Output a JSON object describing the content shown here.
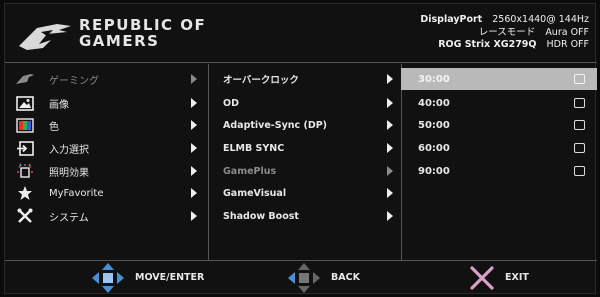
{
  "header": {
    "brand_line1": "REPUBLIC OF",
    "brand_line2": "GAMERS",
    "input": "DisplayPort",
    "resolution": "2560x1440@ 144Hz",
    "mode_label": "レースモード",
    "aura": "Aura OFF",
    "model": "ROG Strix  XG279Q",
    "hdr": "HDR OFF"
  },
  "menu": [
    {
      "label": "ゲーミング",
      "icon": "rog-eye-icon",
      "dimmed": true
    },
    {
      "label": "画像",
      "icon": "image-icon",
      "dimmed": false
    },
    {
      "label": "色",
      "icon": "color-bars-icon",
      "dimmed": false
    },
    {
      "label": "入力選択",
      "icon": "input-select-icon",
      "dimmed": false
    },
    {
      "label": "照明効果",
      "icon": "lighting-icon",
      "dimmed": false
    },
    {
      "label": "MyFavorite",
      "icon": "star-icon",
      "dimmed": false
    },
    {
      "label": "システム",
      "icon": "tools-icon",
      "dimmed": false
    }
  ],
  "submenu": [
    {
      "label": "オーバークロック",
      "dimmed": false
    },
    {
      "label": "OD",
      "dimmed": false
    },
    {
      "label": "Adaptive-Sync (DP)",
      "dimmed": false
    },
    {
      "label": "ELMB SYNC",
      "dimmed": false
    },
    {
      "label": "GamePlus",
      "dimmed": true
    },
    {
      "label": "GameVisual",
      "dimmed": false
    },
    {
      "label": "Shadow Boost",
      "dimmed": false
    }
  ],
  "options": [
    {
      "label": "30:00",
      "selected": true
    },
    {
      "label": "40:00",
      "selected": false
    },
    {
      "label": "50:00",
      "selected": false
    },
    {
      "label": "60:00",
      "selected": false
    },
    {
      "label": "90:00",
      "selected": false
    }
  ],
  "footer": {
    "move_enter": "MOVE/ENTER",
    "back": "BACK",
    "exit": "EXIT"
  },
  "colors": {
    "accent_blue": "#4a90d9",
    "exit_pink": "#d9a0c8",
    "selected_bg": "#b9b9b9"
  }
}
